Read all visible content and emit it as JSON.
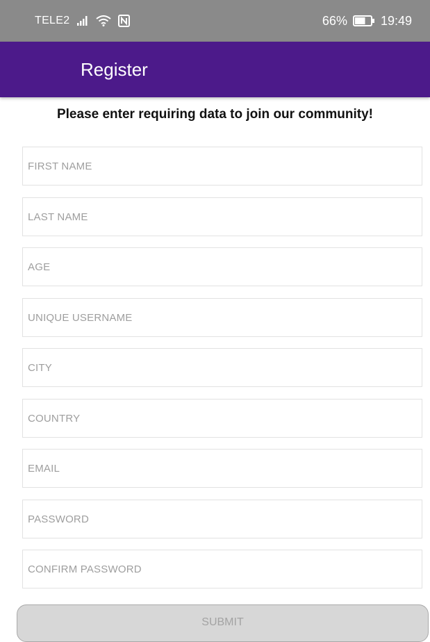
{
  "status_bar": {
    "carrier": "TELE2",
    "battery_percent": "66%",
    "battery_level": 0.66,
    "time": "19:49",
    "icons": [
      "signal-icon",
      "wifi-icon",
      "nfc-icon",
      "battery-icon"
    ]
  },
  "app_bar": {
    "title": "Register",
    "background": "#4c1a8a"
  },
  "form": {
    "subtitle": "Please enter requiring data to join our community!",
    "fields": [
      {
        "name": "first-name",
        "placeholder": "FIRST NAME"
      },
      {
        "name": "last-name",
        "placeholder": "LAST NAME"
      },
      {
        "name": "age",
        "placeholder": "AGE"
      },
      {
        "name": "unique-username",
        "placeholder": "UNIQUE USERNAME"
      },
      {
        "name": "city",
        "placeholder": "CITY"
      },
      {
        "name": "country",
        "placeholder": "COUNTRY"
      },
      {
        "name": "email",
        "placeholder": "EMAIL"
      },
      {
        "name": "password",
        "placeholder": "PASSWORD"
      },
      {
        "name": "confirm-password",
        "placeholder": "CONFIRM PASSWORD"
      }
    ],
    "submit_label": "SUBMIT"
  }
}
